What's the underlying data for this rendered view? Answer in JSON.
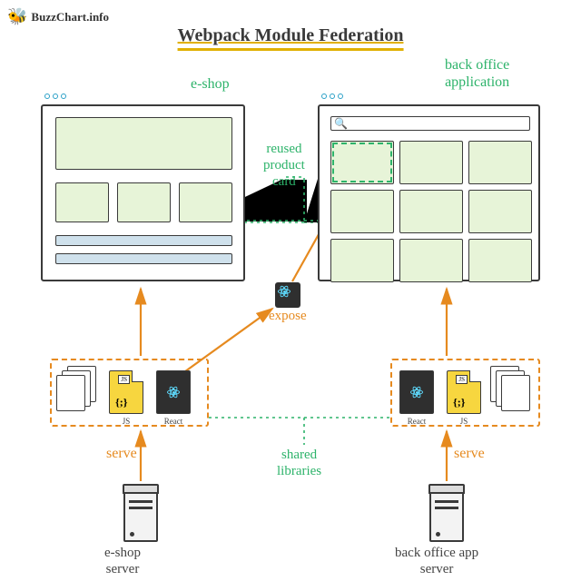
{
  "logo": {
    "text": "BuzzChart.info"
  },
  "title": "Webpack Module Federation",
  "labels": {
    "eshop": "e-shop",
    "backoffice": "back office\napplication",
    "reused": "reused\nproduct\ncard",
    "expose": "expose",
    "shared": "shared\nlibraries",
    "serve": "serve",
    "eshop_server": "e-shop\nserver",
    "back_server": "back office app\nserver"
  },
  "files": {
    "js_tag": "JS",
    "js_braces": "{;}",
    "js_cap": "JS",
    "react_label": "React",
    "react_cap": "React"
  }
}
